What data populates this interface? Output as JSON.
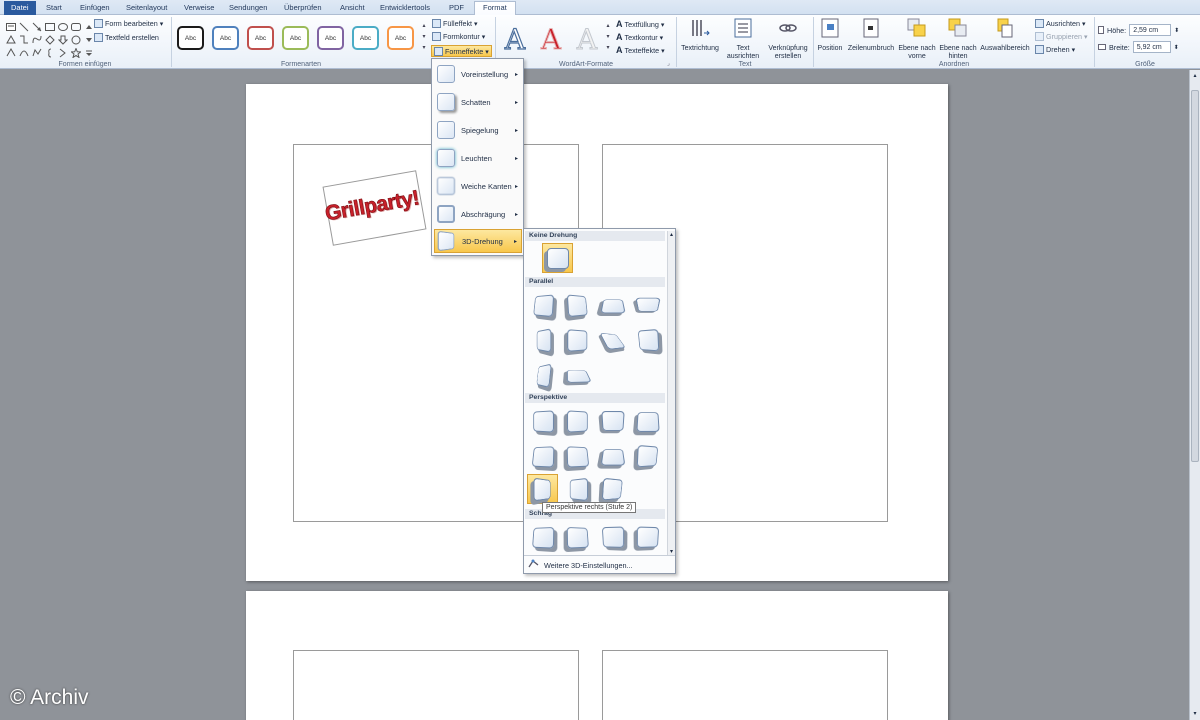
{
  "tabs": [
    "Datei",
    "Start",
    "Einfügen",
    "Seitenlayout",
    "Verweise",
    "Sendungen",
    "Überprüfen",
    "Ansicht",
    "Entwicklertools",
    "PDF",
    "Format"
  ],
  "groups": {
    "formen": "Formen einfügen",
    "formenarten": "Formenarten",
    "wordart": "WordArt-Formate",
    "text": "Text",
    "anordnen": "Anordnen",
    "groesse": "Größe"
  },
  "formen_buttons": {
    "form_bearbeiten": "Form bearbeiten",
    "textfeld": "Textfeld erstellen"
  },
  "style_label": "Abc",
  "style_colors": [
    "#1a1a1a",
    "#4f81bd",
    "#c0504d",
    "#9bbb59",
    "#8064a2",
    "#4bacc6",
    "#f79646"
  ],
  "fill_buttons": {
    "fuelleffekt": "Fülleffekt",
    "formkontur": "Formkontur",
    "formeffekte": "Formeffekte"
  },
  "wordart_letter": "A",
  "text_buttons": {
    "textfuellung": "Textfüllung",
    "textkontur": "Textkontur",
    "texteffekte": "Texteffekte"
  },
  "text_group": {
    "textrichtung": "Textrichtung",
    "ausrichten_1": "Text",
    "ausrichten_2": "ausrichten",
    "verknuepfung_1": "Verknüpfung",
    "verknuepfung_2": "erstellen"
  },
  "anordnen_group": {
    "position": "Position",
    "zeilenumbruch": "Zeilenumbruch",
    "vorne_1": "Ebene nach",
    "vorne_2": "vorne",
    "hinten_1": "Ebene nach",
    "hinten_2": "hinten",
    "auswahl": "Auswahlbereich",
    "ausrichten": "Ausrichten",
    "gruppieren": "Gruppieren",
    "drehen": "Drehen"
  },
  "size": {
    "hoehe_label": "Höhe:",
    "hoehe_value": "2,59 cm",
    "breite_label": "Breite:",
    "breite_value": "5,92 cm"
  },
  "menu_items": [
    "Voreinstellung",
    "Schatten",
    "Spiegelung",
    "Leuchten",
    "Weiche Kanten",
    "Abschrägung",
    "3D-Drehung"
  ],
  "submenu": {
    "keine": "Keine Drehung",
    "parallel": "Parallel",
    "perspektive": "Perspektive",
    "schraeg": "Schräg",
    "more": "Weitere 3D-Einstellungen...",
    "tooltip": "Perspektive rechts (Stufe 2)"
  },
  "wordart_text": "Grillparty!",
  "watermark": "© Archiv",
  "colors": {
    "accent": "#2a5a9e",
    "highlight": "#f8c74c",
    "wordart_red": "#c8202a"
  }
}
